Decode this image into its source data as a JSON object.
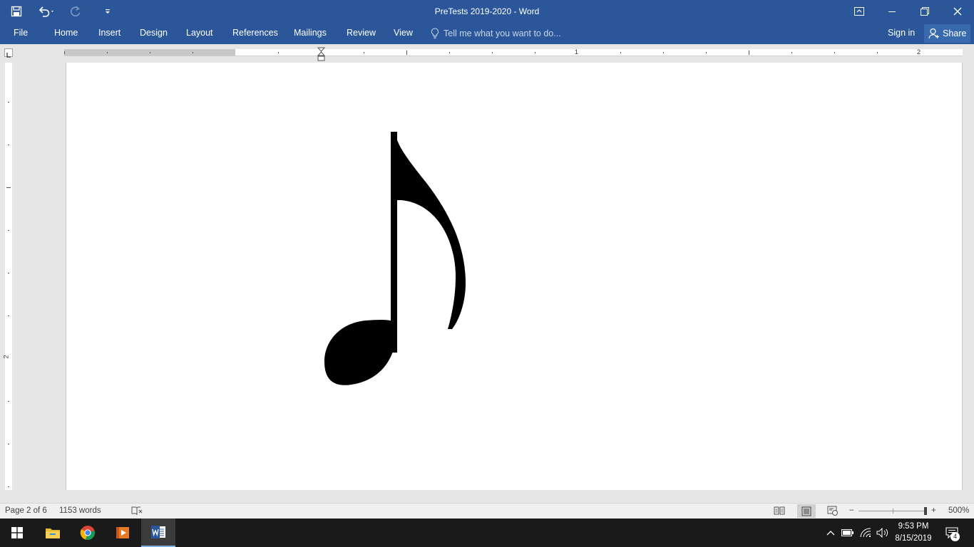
{
  "window": {
    "title": "PreTests 2019-2020 - Word"
  },
  "quick_access": {
    "save_icon": "save-icon",
    "undo_icon": "undo-icon",
    "redo_icon": "redo-icon",
    "customize_icon": "customize-qat-icon"
  },
  "ribbon": {
    "tabs": [
      {
        "label": "File"
      },
      {
        "label": "Home"
      },
      {
        "label": "Insert"
      },
      {
        "label": "Design"
      },
      {
        "label": "Layout"
      },
      {
        "label": "References"
      },
      {
        "label": "Mailings"
      },
      {
        "label": "Review"
      },
      {
        "label": "View"
      }
    ],
    "tell_me_placeholder": "Tell me what you want to do...",
    "sign_in": "Sign in",
    "share": "Share"
  },
  "ruler": {
    "h_numbers": [
      "1",
      "2"
    ],
    "v_number": "2"
  },
  "document": {
    "content_icon": "eighth-note-icon"
  },
  "status": {
    "page": "Page 2 of 6",
    "words": "1153 words",
    "zoom": "500%",
    "zoom_fraction": 0.88
  },
  "taskbar": {
    "apps": [
      "windows-start",
      "file-explorer",
      "chrome",
      "media-player",
      "word"
    ],
    "time": "9:53 PM",
    "date": "8/15/2019",
    "notifications": "4"
  },
  "colors": {
    "word_blue": "#2b579a",
    "taskbar": "#1a1a1a"
  }
}
